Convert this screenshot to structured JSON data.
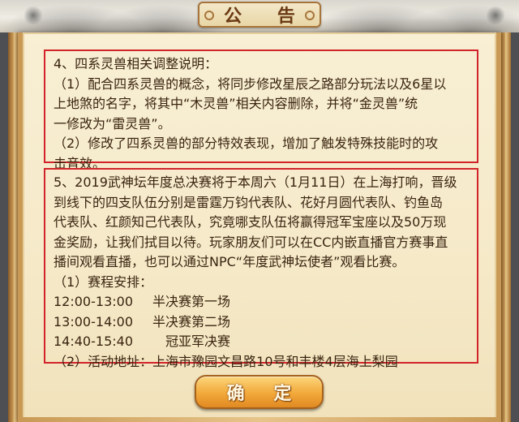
{
  "dialog": {
    "title": "公 告",
    "confirm_label": "确 定"
  },
  "notice_1": {
    "lines": [
      "4、四系灵兽相关调整说明：",
      "（1）配合四系灵兽的概念，将同步修改星辰之路部分玩法以及6星以",
      "上地煞的名字，将其中“木灵兽”相关内容删除，并将“金灵兽”统",
      "一修改为“雷灵兽”。",
      "（2）修改了四系灵兽的部分特效表现，增加了触发特殊技能时的攻",
      "击音效。"
    ]
  },
  "notice_2": {
    "lines": [
      "5、2019武神坛年度总决赛将于本周六（1月11日）在上海打响，晋级",
      "到线下的四支队伍分别是雷霆万钧代表队、花好月圆代表队、钓鱼岛",
      "代表队、红颜知己代表队，究竟哪支队伍将赢得冠军宝座以及50万现",
      "金奖励，让我们拭目以待。玩家朋友们可以在CC内嵌直播官方赛事直",
      "播间观看直播，也可以通过NPC“年度武神坛使者”观看比赛。",
      "（1）赛程安排："
    ],
    "schedule": [
      {
        "time": "12:00-13:00",
        "event": "半决赛第一场"
      },
      {
        "time": "13:00-14:00",
        "event": "半决赛第二场"
      },
      {
        "time": "14:40-15:40",
        "event": "　冠亚军决赛"
      }
    ],
    "venue": "（2）活动地址：上海市豫园文昌路10号和丰楼4层海上梨园"
  }
}
